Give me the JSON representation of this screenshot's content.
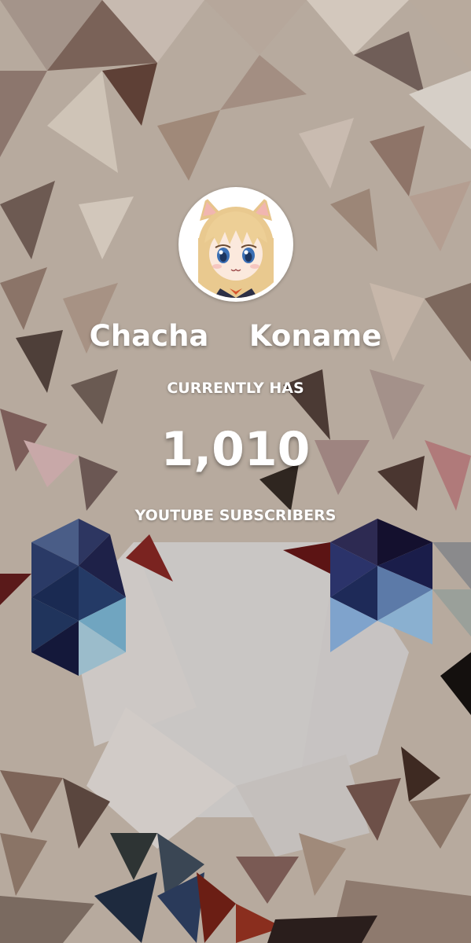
{
  "channel": {
    "name": "Chacha    Koname"
  },
  "labels": {
    "currently_has": "CURRENTLY HAS",
    "subscribers": "YOUTUBE SUBSCRIBERS"
  },
  "stats": {
    "subscriber_count": "1,010"
  },
  "icons": {
    "avatar": "anime-cat-ear-girl-avatar-icon"
  },
  "colors": {
    "text": "#ffffff",
    "avatar_ring": "#ffffff"
  }
}
